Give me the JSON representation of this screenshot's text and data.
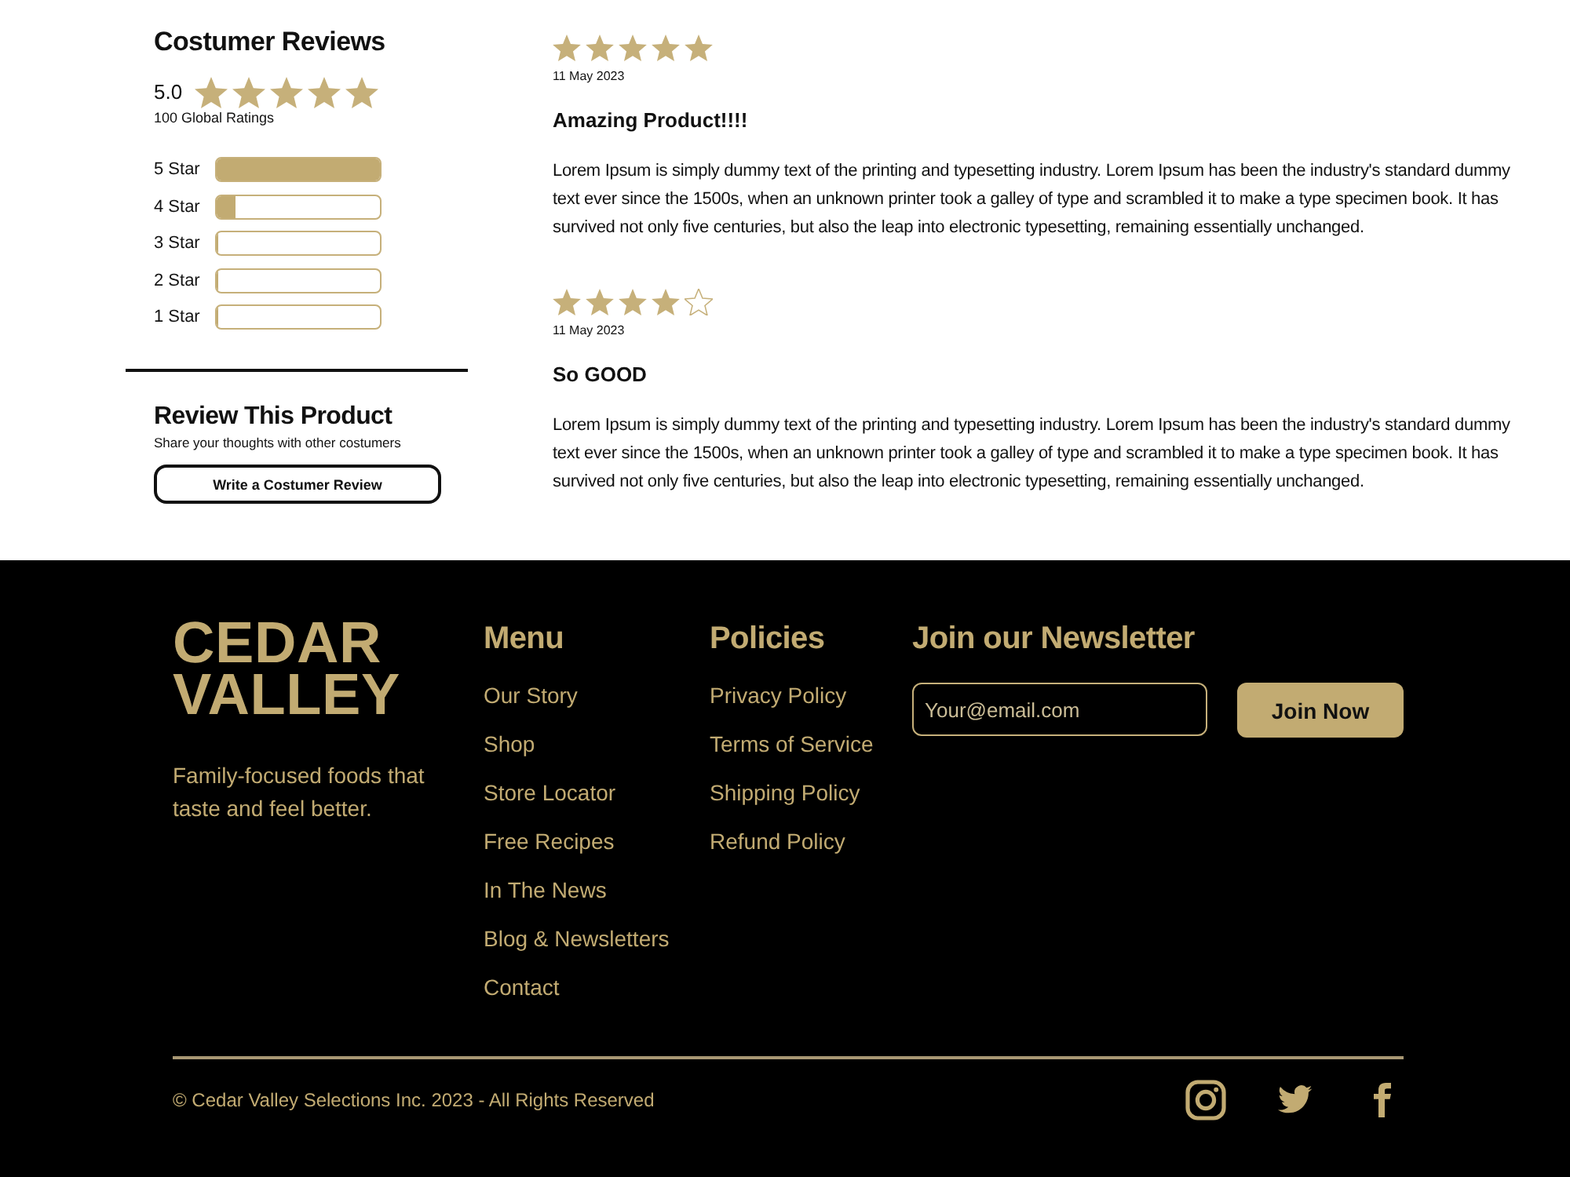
{
  "reviews_summary": {
    "title": "Costumer Reviews",
    "rating": "5.0",
    "stars": 5,
    "ratings_count": "100 Global Ratings",
    "breakdown": [
      {
        "label": "5 Star",
        "level": 1
      },
      {
        "label": "4 Star",
        "level": 0.12
      },
      {
        "label": "3 Star",
        "level": 0
      },
      {
        "label": "2 Star",
        "level": 0
      },
      {
        "label": "1 Star",
        "level": 0
      }
    ]
  },
  "review_prompt": {
    "title": "Review This Product",
    "subtitle": "Share your thoughts with other costumers",
    "button": "Write a Costumer Review"
  },
  "reviews": [
    {
      "stars": 5,
      "date": "11 May 2023",
      "title": "Amazing Product!!!!",
      "body": "Lorem Ipsum is simply dummy text of the printing and typesetting industry. Lorem Ipsum has been the industry's standard dummy text ever since the 1500s, when an unknown printer took a galley of type and scrambled it to make a type specimen book. It has survived not only five centuries, but also the leap into electronic typesetting, remaining essentially unchanged."
    },
    {
      "stars": 4,
      "date": "11 May 2023",
      "title": "So GOOD",
      "body": "Lorem Ipsum is simply dummy text of the printing and typesetting industry. Lorem Ipsum has been the industry's standard dummy text ever since the 1500s, when an unknown printer took a galley of type and scrambled it to make a type specimen book. It has survived not only five centuries, but also the leap into electronic typesetting, remaining essentially unchanged."
    }
  ],
  "footer": {
    "logo": "CEDAR VALLEY",
    "tagline": "Family-focused foods that taste and feel better.",
    "menu": {
      "title": "Menu",
      "items": [
        "Our Story",
        "Shop",
        "Store Locator",
        "Free Recipes",
        "In The News",
        "Blog & Newsletters",
        "Contact"
      ]
    },
    "policies": {
      "title": "Policies",
      "items": [
        "Privacy Policy",
        "Terms of Service",
        "Shipping Policy",
        "Refund Policy"
      ]
    },
    "newsletter": {
      "title": "Join our Newsletter",
      "placeholder": "Your@email.com",
      "button": "Join Now"
    },
    "copyright": "© Cedar Valley Selections Inc. 2023 - All Rights Reserved"
  }
}
